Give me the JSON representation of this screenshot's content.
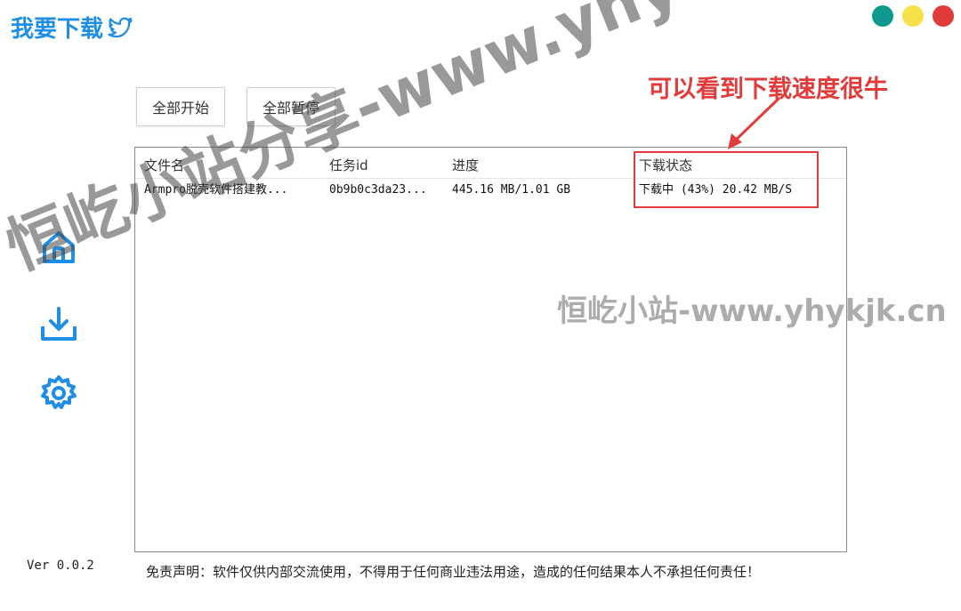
{
  "app": {
    "title": "我要下载",
    "window_buttons": [
      {
        "name": "minimize",
        "color": "#10998e"
      },
      {
        "name": "maximize",
        "color": "#f5e14a"
      },
      {
        "name": "close",
        "color": "#e23b3b"
      }
    ]
  },
  "toolbar": {
    "start_all_label": "全部开始",
    "pause_all_label": "全部暂停"
  },
  "sidebar": {
    "items": [
      {
        "icon": "home-icon",
        "color": "#1f8ee6"
      },
      {
        "icon": "download-icon",
        "color": "#1f8ee6"
      },
      {
        "icon": "gear-icon",
        "color": "#1f8ee6"
      }
    ]
  },
  "table": {
    "headers": {
      "file_name": "文件名",
      "task_id": "任务id",
      "progress": "进度",
      "status": "下载状态"
    },
    "rows": [
      {
        "file_name": "Armpro脱壳软件搭建教...",
        "task_id": "0b9b0c3da23...",
        "progress": "445.16 MB/1.01 GB",
        "status": "下载中 (43%) 20.42 MB/S"
      }
    ]
  },
  "annotation": {
    "text": "可以看到下载速度很牛",
    "color": "#e23b3b"
  },
  "footer": {
    "version": "Ver 0.0.2",
    "disclaimer": "免责声明：软件仅供内部交流使用，不得用于任何商业违法用途，造成的任何结果本人不承担任何责任！"
  },
  "watermarks": {
    "diagonal": "恒屹小站分享-www.yhykjk.cn",
    "horizontal": "恒屹小站-www.yhykjk.cn"
  }
}
